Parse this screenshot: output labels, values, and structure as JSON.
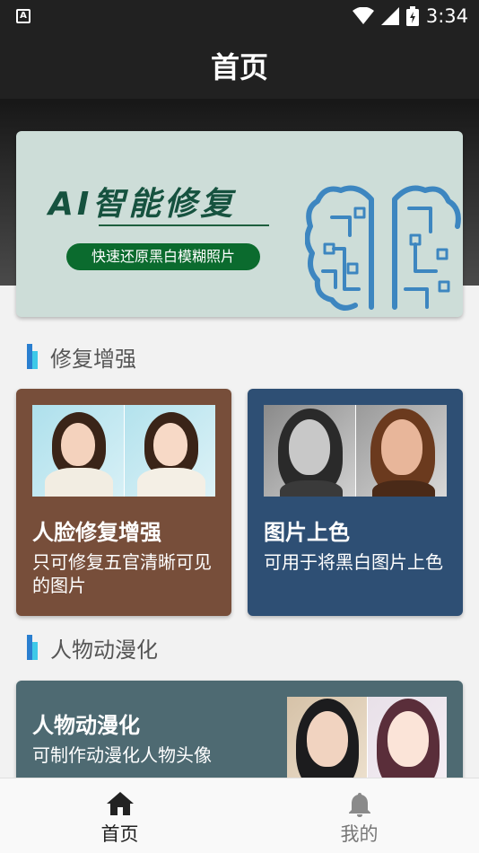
{
  "status_bar": {
    "time": "3:34",
    "notification_icon": "A"
  },
  "app_bar": {
    "title": "首页"
  },
  "banner": {
    "headline": "AI智能修复",
    "tagline": "快速还原黑白模糊照片",
    "accent": "#16523f",
    "pill_color": "#0b6b2e",
    "illustration": "circuit-brain-icon"
  },
  "sections": {
    "repair": {
      "label": "修复增强"
    },
    "cartoon": {
      "label": "人物动漫化"
    }
  },
  "cards": {
    "face_repair": {
      "title": "人脸修复增强",
      "desc": "只可修复五官清晰可见的图片",
      "color": "#774e3a"
    },
    "colorize": {
      "title": "图片上色",
      "desc": "可用于将黑白图片上色",
      "color": "#2e4f74"
    },
    "anime": {
      "title": "人物动漫化",
      "desc": "可制作动漫化人物头像",
      "color": "#4e6a72"
    }
  },
  "bottom_nav": {
    "home": {
      "label": "首页",
      "icon": "home-icon",
      "active": true
    },
    "mine": {
      "label": "我的",
      "icon": "bell-icon",
      "active": false
    }
  }
}
